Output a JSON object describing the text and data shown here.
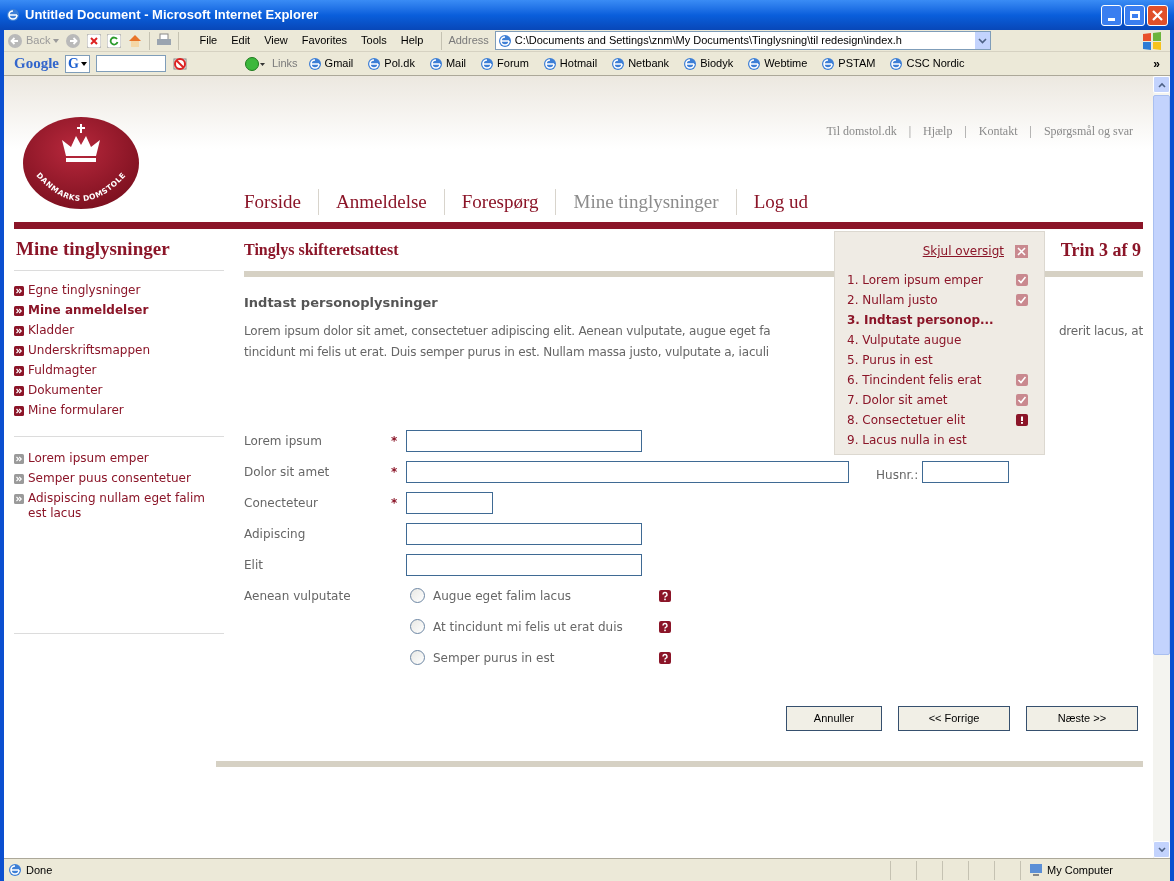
{
  "window": {
    "title": "Untitled Document - Microsoft Internet Explorer"
  },
  "toolbar": {
    "back": "Back",
    "menus": [
      "File",
      "Edit",
      "View",
      "Favorites",
      "Tools",
      "Help"
    ],
    "address_label": "Address",
    "address": "C:\\Documents and Settings\\znm\\My Documents\\Tinglysning\\til redesign\\index.h"
  },
  "links_bar": {
    "google": "Google",
    "g_button": "G",
    "links_label": "Links",
    "links": [
      "Gmail",
      "Pol.dk",
      "Mail",
      "Forum",
      "Hotmail",
      "Netbank",
      "Biodyk",
      "Webtime",
      "PSTAM",
      "CSC Nordic"
    ],
    "more": "»"
  },
  "page": {
    "logo_text": "DANMARKS DOMSTOLE",
    "top_links": [
      "Til domstol.dk",
      "Hjælp",
      "Kontakt",
      "Spørgsmål og svar"
    ],
    "top_separator": "|",
    "nav": [
      {
        "label": "Forside",
        "selected": false
      },
      {
        "label": "Anmeldelse",
        "selected": false
      },
      {
        "label": "Forespørg",
        "selected": false
      },
      {
        "label": "Mine tinglysninger",
        "selected": true
      },
      {
        "label": "Log ud",
        "selected": false
      }
    ],
    "sidebar": {
      "title": "Mine tinglysninger",
      "items": [
        {
          "label": "Egne tinglysninger",
          "selected": false
        },
        {
          "label": "Mine anmeldelser",
          "selected": true
        },
        {
          "label": "Kladder",
          "selected": false
        },
        {
          "label": "Underskriftsmappen",
          "selected": false
        },
        {
          "label": "Fuldmagter",
          "selected": false
        },
        {
          "label": "Dokumenter",
          "selected": false
        },
        {
          "label": "Mine formularer",
          "selected": false
        }
      ],
      "secondary_items": [
        "Lorem ipsum emper",
        "Semper puus consentetuer",
        "Adispiscing nullam eget falim est lacus"
      ]
    },
    "main": {
      "title": "Tinglys skifteretsattest",
      "step": "Trin 3 af 9",
      "section_title": "Indtast personoplysninger",
      "paragraph_lines": [
        [
          "Lorem ipsum dolor sit amet, consectetuer adipiscing elit. Aenean vulputate, augue eget fa",
          "drerit lacus, at"
        ],
        [
          "tincidunt mi felis ut erat. Duis semper purus in est. Nullam massa justo, vulputate a, iaculi"
        ]
      ],
      "fields": [
        {
          "label": "Lorem ipsum",
          "required": true
        },
        {
          "label": "Dolor sit amet",
          "required": true,
          "side_label": "Husnr.:"
        },
        {
          "label": "Conecteteur",
          "required": true
        },
        {
          "label": "Adipiscing",
          "required": false
        },
        {
          "label": "Elit",
          "required": false
        }
      ],
      "required_mark": "*",
      "radio_group": {
        "label": "Aenean vulputate",
        "options": [
          {
            "label": "Augue eget falim lacus",
            "selected": false
          },
          {
            "label": "At tincidunt mi felis ut erat duis",
            "selected": false
          },
          {
            "label": "Semper purus in est",
            "selected": false
          }
        ]
      },
      "buttons": [
        "Annuller",
        "<< Forrige",
        "Næste >>"
      ]
    },
    "overview": {
      "hide_link": "Skjul oversigt",
      "steps": [
        {
          "label": "1. Lorem ipsum emper",
          "completed": true,
          "current": false,
          "error": false
        },
        {
          "label": "2. Nullam justo",
          "completed": true,
          "current": false,
          "error": false
        },
        {
          "label": "3. Indtast personop...",
          "completed": false,
          "current": true,
          "error": false
        },
        {
          "label": "4. Vulputate augue",
          "completed": false,
          "current": false,
          "error": false
        },
        {
          "label": "5. Purus in est",
          "completed": false,
          "current": false,
          "error": false
        },
        {
          "label": "6. Tincindent felis erat",
          "completed": true,
          "current": false,
          "error": false
        },
        {
          "label": "7. Dolor sit amet",
          "completed": true,
          "current": false,
          "error": false
        },
        {
          "label": "8. Consectetuer elit",
          "completed": false,
          "current": false,
          "error": true
        },
        {
          "label": "9. Lacus nulla in est",
          "completed": false,
          "current": false,
          "error": false
        }
      ]
    }
  },
  "status_bar": {
    "text": "Done",
    "zone": "My Computer"
  }
}
